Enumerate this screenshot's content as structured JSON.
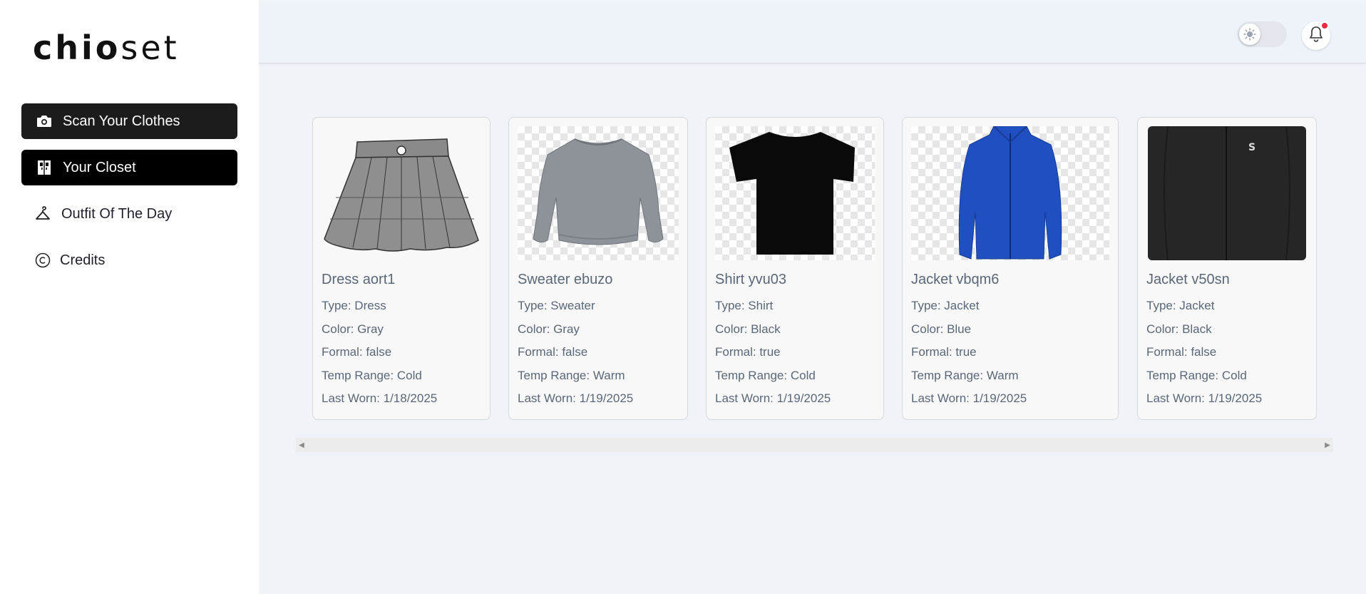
{
  "logo": {
    "bold": "chio",
    "light": "set"
  },
  "nav": {
    "items": [
      {
        "label": "Scan Your Clothes",
        "icon": "camera-icon"
      },
      {
        "label": "Your Closet",
        "icon": "closet-icon"
      },
      {
        "label": "Outfit Of The Day",
        "icon": "hanger-icon"
      },
      {
        "label": "Credits",
        "icon": "copyright-icon"
      }
    ]
  },
  "header": {
    "theme_toggle_icon": "sun-icon",
    "notification_icon": "bell-icon",
    "notification_dot_color": "#e03040"
  },
  "closet": {
    "items": [
      {
        "name": "Dress aort1",
        "type": "Type: Dress",
        "color": "Color: Gray",
        "formal": "Formal: false",
        "temp": "Temp Range: Cold",
        "last_worn": "Last Worn: 1/18/2025",
        "image": "gray-pleated-skirt"
      },
      {
        "name": "Sweater ebuzo",
        "type": "Type: Sweater",
        "color": "Color: Gray",
        "formal": "Formal: false",
        "temp": "Temp Range: Warm",
        "last_worn": "Last Worn: 1/19/2025",
        "image": "gray-sweater"
      },
      {
        "name": "Shirt yvu03",
        "type": "Type: Shirt",
        "color": "Color: Black",
        "formal": "Formal: true",
        "temp": "Temp Range: Cold",
        "last_worn": "Last Worn: 1/19/2025",
        "image": "black-tshirt"
      },
      {
        "name": "Jacket vbqm6",
        "type": "Type: Jacket",
        "color": "Color: Blue",
        "formal": "Formal: true",
        "temp": "Temp Range: Warm",
        "last_worn": "Last Worn: 1/19/2025",
        "image": "blue-fleece-jacket"
      },
      {
        "name": "Jacket v50sn",
        "type": "Type: Jacket",
        "color": "Color: Black",
        "formal": "Formal: false",
        "temp": "Temp Range: Cold",
        "last_worn": "Last Worn: 1/19/2025",
        "image": "black-softshell-jacket"
      }
    ]
  },
  "scrollbar": {
    "left_icon": "triangle-left-icon",
    "right_icon": "triangle-right-icon"
  }
}
